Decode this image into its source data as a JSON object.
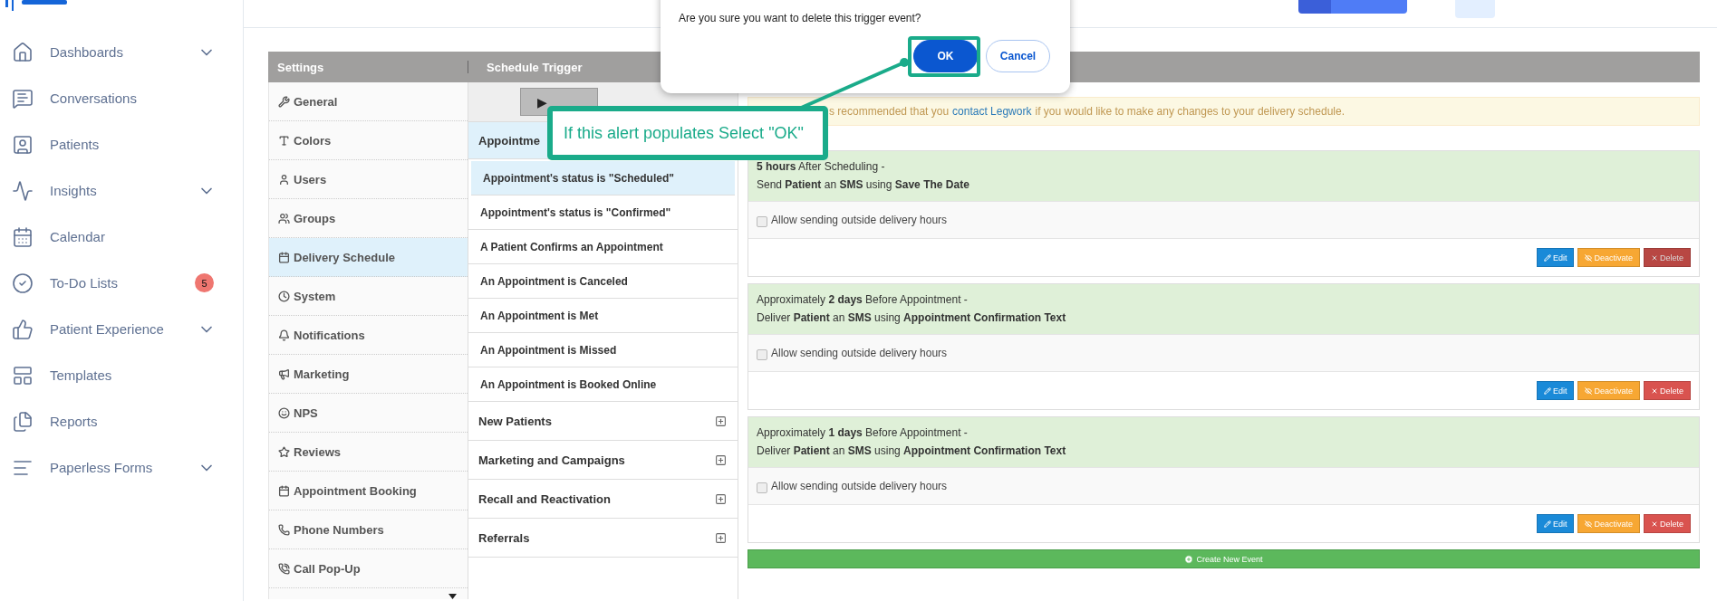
{
  "sidebar": {
    "items": [
      {
        "label": "Dashboards",
        "expandable": true,
        "selected": false
      },
      {
        "label": "Conversations",
        "expandable": false,
        "selected": false
      },
      {
        "label": "Patients",
        "expandable": false,
        "selected": false
      },
      {
        "label": "Insights",
        "expandable": true,
        "selected": false
      },
      {
        "label": "Calendar",
        "expandable": false,
        "selected": false
      },
      {
        "label": "To-Do Lists",
        "expandable": false,
        "badge": "5",
        "selected": false
      },
      {
        "label": "Patient Experience",
        "expandable": true,
        "selected": false
      },
      {
        "label": "Templates",
        "expandable": false,
        "selected": false
      },
      {
        "label": "Reports",
        "expandable": false,
        "selected": false
      },
      {
        "label": "Paperless Forms",
        "expandable": true,
        "selected": false
      }
    ]
  },
  "settings": {
    "title": "Settings",
    "items": [
      {
        "label": "General",
        "selected": false
      },
      {
        "label": "Colors",
        "selected": false
      },
      {
        "label": "Users",
        "selected": false
      },
      {
        "label": "Groups",
        "selected": false
      },
      {
        "label": "Delivery Schedule",
        "selected": true
      },
      {
        "label": "System",
        "selected": false
      },
      {
        "label": "Notifications",
        "selected": false
      },
      {
        "label": "Marketing",
        "selected": false
      },
      {
        "label": "NPS",
        "selected": false
      },
      {
        "label": "Reviews",
        "selected": false
      },
      {
        "label": "Appointment Booking",
        "selected": false
      },
      {
        "label": "Phone Numbers",
        "selected": false
      },
      {
        "label": "Call Pop-Up",
        "selected": false
      }
    ]
  },
  "triggers": {
    "title": "Schedule Trigger",
    "play_button": "▶",
    "groups": [
      {
        "label": "Appointme",
        "expanded": true,
        "items": [
          {
            "label": "Appointment's status is \"Scheduled\"",
            "selected": true
          },
          {
            "label": "Appointment's status is \"Confirmed\"",
            "selected": false
          },
          {
            "label": "A Patient Confirms an Appointment",
            "selected": false
          },
          {
            "label": "An Appointment is Canceled",
            "selected": false
          },
          {
            "label": "An Appointment is Met",
            "selected": false
          },
          {
            "label": "An Appointment is Missed",
            "selected": false
          },
          {
            "label": "An Appointment is Booked Online",
            "selected": false
          }
        ]
      },
      {
        "label": "New Patients",
        "expanded": false
      },
      {
        "label": "Marketing and Campaigns",
        "expanded": false
      },
      {
        "label": "Recall and Reactivation",
        "expanded": false
      },
      {
        "label": "Referrals",
        "expanded": false
      }
    ]
  },
  "notice": {
    "before": "s recommended that you",
    "link": "contact Legwork",
    "after": "if you would like to make any changes to your delivery schedule."
  },
  "events": [
    {
      "timing": "**5 hours** After Scheduling -",
      "action": "Send **Patient** an **SMS** using **Save The Date**",
      "option": {
        "label": "Allow sending outside delivery hours",
        "checked": false
      },
      "buttons": [
        {
          "label": "Edit",
          "kind": "edit"
        },
        {
          "label": "Deactivate",
          "kind": "deactivate"
        },
        {
          "label": "Delete",
          "kind": "delete",
          "hovered": true
        }
      ]
    },
    {
      "timing": "Approximately **2 days** Before Appointment -",
      "action": "Deliver **Patient** an **SMS** using **Appointment Confirmation Text**",
      "option": {
        "label": "Allow sending outside delivery hours",
        "checked": false
      },
      "buttons": [
        {
          "label": "Edit",
          "kind": "edit"
        },
        {
          "label": "Deactivate",
          "kind": "deactivate"
        },
        {
          "label": "Delete",
          "kind": "delete",
          "hovered": false
        }
      ]
    },
    {
      "timing": "Approximately **1 days** Before Appointment -",
      "action": "Deliver **Patient** an **SMS** using **Appointment Confirmation Text**",
      "option": {
        "label": "Allow sending outside delivery hours",
        "checked": false
      },
      "buttons": [
        {
          "label": "Edit",
          "kind": "edit"
        },
        {
          "label": "Deactivate",
          "kind": "deactivate"
        },
        {
          "label": "Delete",
          "kind": "delete",
          "hovered": false
        }
      ]
    }
  ],
  "create_button": "Create New Event",
  "dialog": {
    "message": "Are you sure you want to delete this trigger event?",
    "buttons": [
      {
        "label": "OK",
        "kind": "primary"
      },
      {
        "label": "Cancel",
        "kind": "secondary"
      }
    ]
  },
  "callout": {
    "text": "If this alert populates Select \"OK\""
  }
}
